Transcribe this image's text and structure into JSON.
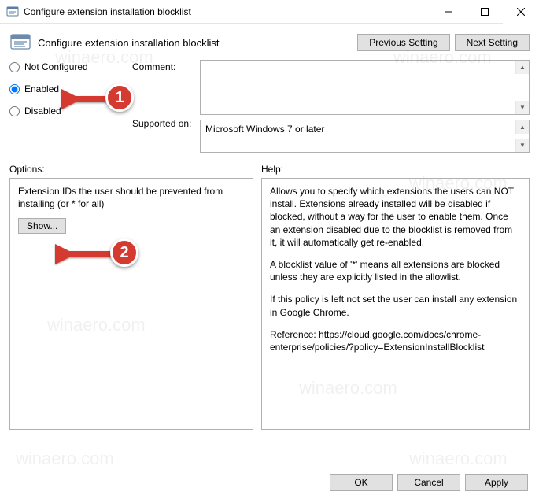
{
  "window": {
    "title": "Configure extension installation blocklist"
  },
  "header": {
    "heading": "Configure extension installation blocklist",
    "prev": "Previous Setting",
    "next": "Next Setting"
  },
  "state": {
    "not_configured": "Not Configured",
    "enabled": "Enabled",
    "disabled": "Disabled",
    "comment_label": "Comment:",
    "comment_value": "",
    "supported_label": "Supported on:",
    "supported_value": "Microsoft Windows 7 or later"
  },
  "sections": {
    "options_label": "Options:",
    "help_label": "Help:"
  },
  "options": {
    "desc": "Extension IDs the user should be prevented from installing (or * for all)",
    "show": "Show..."
  },
  "help": {
    "p1": "Allows you to specify which extensions the users can NOT install. Extensions already installed will be disabled if blocked, without a way for the user to enable them. Once an extension disabled due to the blocklist is removed from it, it will automatically get re-enabled.",
    "p2": "A blocklist value of '*' means all extensions are blocked unless they are explicitly listed in the allowlist.",
    "p3": "If this policy is left not set the user can install any extension in Google Chrome.",
    "p4": "Reference: https://cloud.google.com/docs/chrome-enterprise/policies/?policy=ExtensionInstallBlocklist"
  },
  "footer": {
    "ok": "OK",
    "cancel": "Cancel",
    "apply": "Apply"
  },
  "callouts": {
    "c1": "1",
    "c2": "2"
  },
  "watermark": "winaero.com"
}
